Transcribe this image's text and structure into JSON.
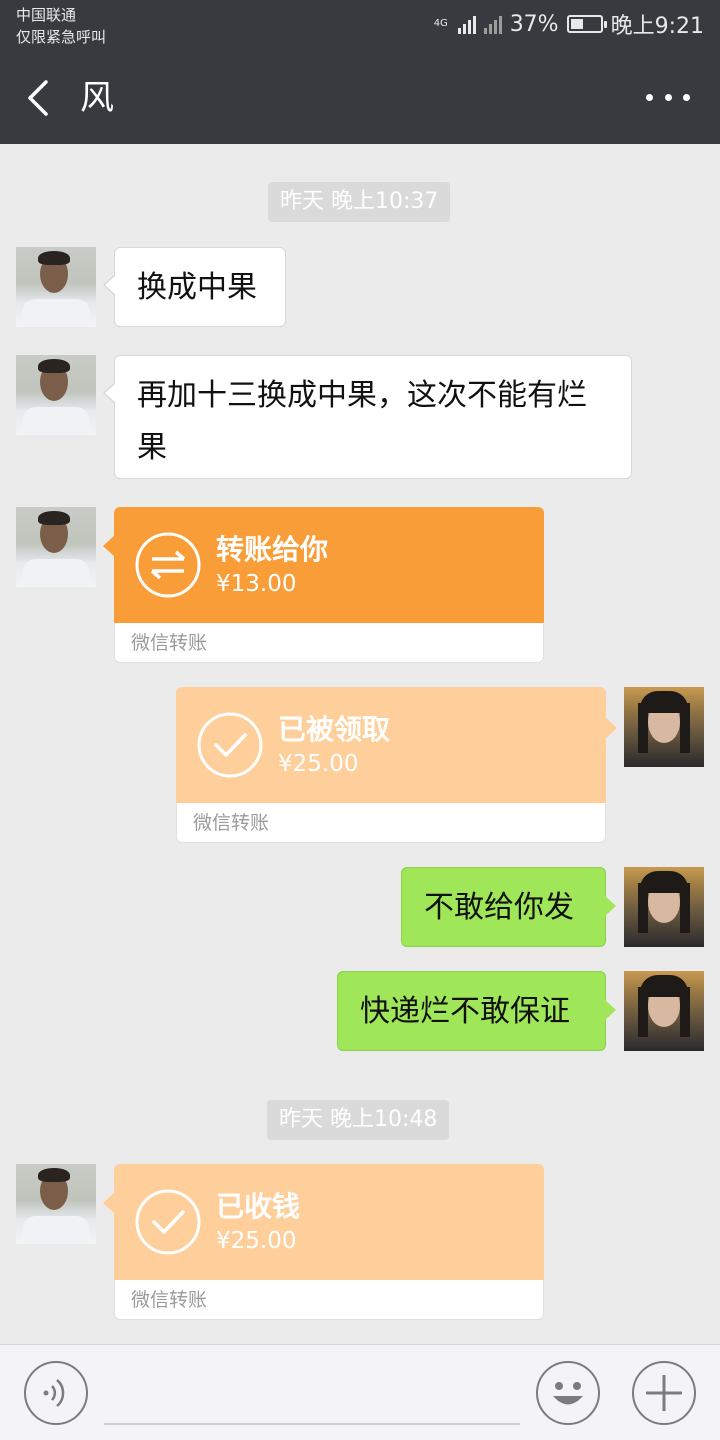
{
  "status_bar": {
    "carrier": "中国联通",
    "carrier_note": "仅限紧急呼叫",
    "network": "4G",
    "battery": "37%",
    "time": "晚上9:21"
  },
  "header": {
    "title": "风"
  },
  "chat": {
    "timestamps": [
      "昨天 晚上10:37",
      "昨天 晚上10:48"
    ],
    "messages": [
      {
        "text": "换成中果"
      },
      {
        "text": "再加十三换成中果，这次不能有烂果"
      },
      {
        "title": "转账给你",
        "amount": "¥13.00",
        "footer": "微信转账"
      },
      {
        "title": "已被领取",
        "amount": "¥25.00",
        "footer": "微信转账"
      },
      {
        "text": "不敢给你发"
      },
      {
        "text": "快递烂不敢保证"
      },
      {
        "title": "已收钱",
        "amount": "¥25.00",
        "footer": "微信转账"
      }
    ]
  },
  "colors": {
    "header_bg": "#393a3f",
    "chat_bg": "#ebebeb",
    "green_bubble": "#9fe658",
    "transfer_orange": "#f99d38",
    "transfer_light_orange": "#fecf9a"
  },
  "icons": [
    "back-arrow-icon",
    "more-dots-icon",
    "transfer-arrows-icon",
    "check-circle-icon",
    "voice-icon",
    "emoji-icon",
    "plus-icon"
  ]
}
